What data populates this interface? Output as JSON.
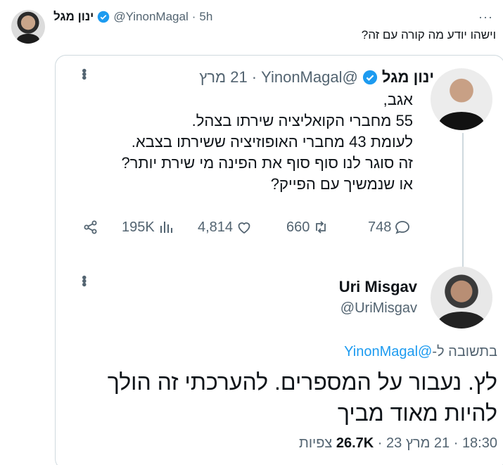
{
  "outer": {
    "name": "ינון מגל",
    "handle": "@YinonMagal",
    "sep": "·",
    "time": "5h",
    "more": "···",
    "text": "וישהו יודע מה קורה עם זה?"
  },
  "quote1": {
    "name": "ינון מגל",
    "handle": "@YinonMagal",
    "sep": "·",
    "date": "21 מרץ",
    "lines": [
      "אגב,",
      "55 מחברי הקואליציה שירתו בצהל.",
      "לעומת 43 מחברי האופוזיציה ששירתו בצבא.",
      "זה סוגר לנו סוף סוף את הפינה מי שירת יותר?",
      "או שנמשיך עם הפייק?"
    ],
    "actions": {
      "views": "195K",
      "likes": "4,814",
      "retweets": "660",
      "replies": "748"
    }
  },
  "quote2": {
    "name": "Uri Misgav",
    "handle": "@UriMisgav",
    "reply_prefix": "בתשובה ל-",
    "reply_to": "@YinonMagal",
    "body": "לץ. נעבור על המספרים. להערכתי זה הולך להיות מאוד מביך",
    "time": "18:30",
    "date": "21 מרץ 23",
    "views": "26.7K",
    "views_label": "צפיות"
  },
  "colors": {
    "accent": "#1d9bf0",
    "muted": "#536471",
    "text": "#0f1419"
  }
}
